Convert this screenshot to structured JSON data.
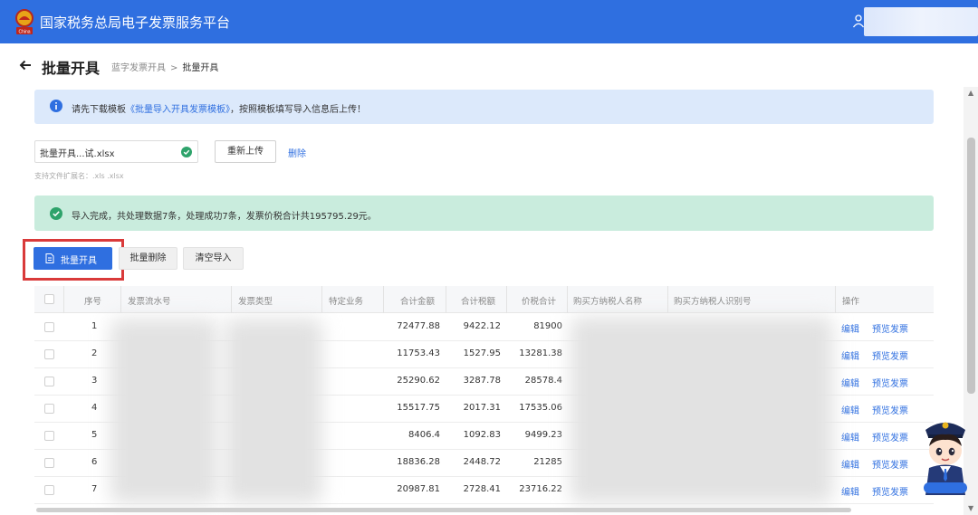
{
  "header": {
    "brand": "国家税务总局电子发票服务平台",
    "logo_caption": "China",
    "user_icon": "user-icon"
  },
  "page": {
    "title": "批量开具",
    "back_icon": "back-arrow-icon",
    "breadcrumb": [
      "蓝字发票开具",
      "批量开具"
    ],
    "breadcrumb_sep": ">"
  },
  "notice": {
    "icon": "info-icon",
    "prefix": "请先下载模板",
    "template_link": "《批量导入开具发票模板》",
    "suffix": "，按照模板填写导入信息后上传！"
  },
  "upload": {
    "file_name": "批量开具...试.xlsx",
    "status_icon": "check-circle-icon",
    "reupload_label": "重新上传",
    "delete_label": "删除",
    "hint": "支持文件扩展名：.xls .xlsx"
  },
  "result": {
    "icon": "check-circle-icon",
    "message": "导入完成，共处理数据7条，处理成功7条，发票价税合计共195795.29元。"
  },
  "toolbar": {
    "issue_label": "批量开具",
    "delete_label": "批量删除",
    "clear_label": "清空导入",
    "issue_icon": "document-icon"
  },
  "table": {
    "columns": [
      "序号",
      "发票流水号",
      "发票类型",
      "特定业务",
      "合计金额",
      "合计税额",
      "价税合计",
      "购买方纳税人名称",
      "购买方纳税人识别号",
      "操作"
    ],
    "action_edit": "编辑",
    "action_preview": "预览发票",
    "rows": [
      {
        "no": "1",
        "amount": "72477.88",
        "tax": "9422.12",
        "total": "81900"
      },
      {
        "no": "2",
        "amount": "11753.43",
        "tax": "1527.95",
        "total": "13281.38"
      },
      {
        "no": "3",
        "amount": "25290.62",
        "tax": "3287.78",
        "total": "28578.4"
      },
      {
        "no": "4",
        "amount": "15517.75",
        "tax": "2017.31",
        "total": "17535.06"
      },
      {
        "no": "5",
        "amount": "8406.4",
        "tax": "1092.83",
        "total": "9499.23"
      },
      {
        "no": "6",
        "amount": "18836.28",
        "tax": "2448.72",
        "total": "21285"
      },
      {
        "no": "7",
        "amount": "20987.81",
        "tax": "2728.41",
        "total": "23716.22"
      }
    ]
  },
  "mascot": {
    "icon": "tax-officer-mascot-icon"
  },
  "colors": {
    "brand": "#2f6fe0",
    "highlight": "#d93a3a",
    "info_bg": "#dce9fb",
    "success_bg": "#c9ecdd"
  }
}
